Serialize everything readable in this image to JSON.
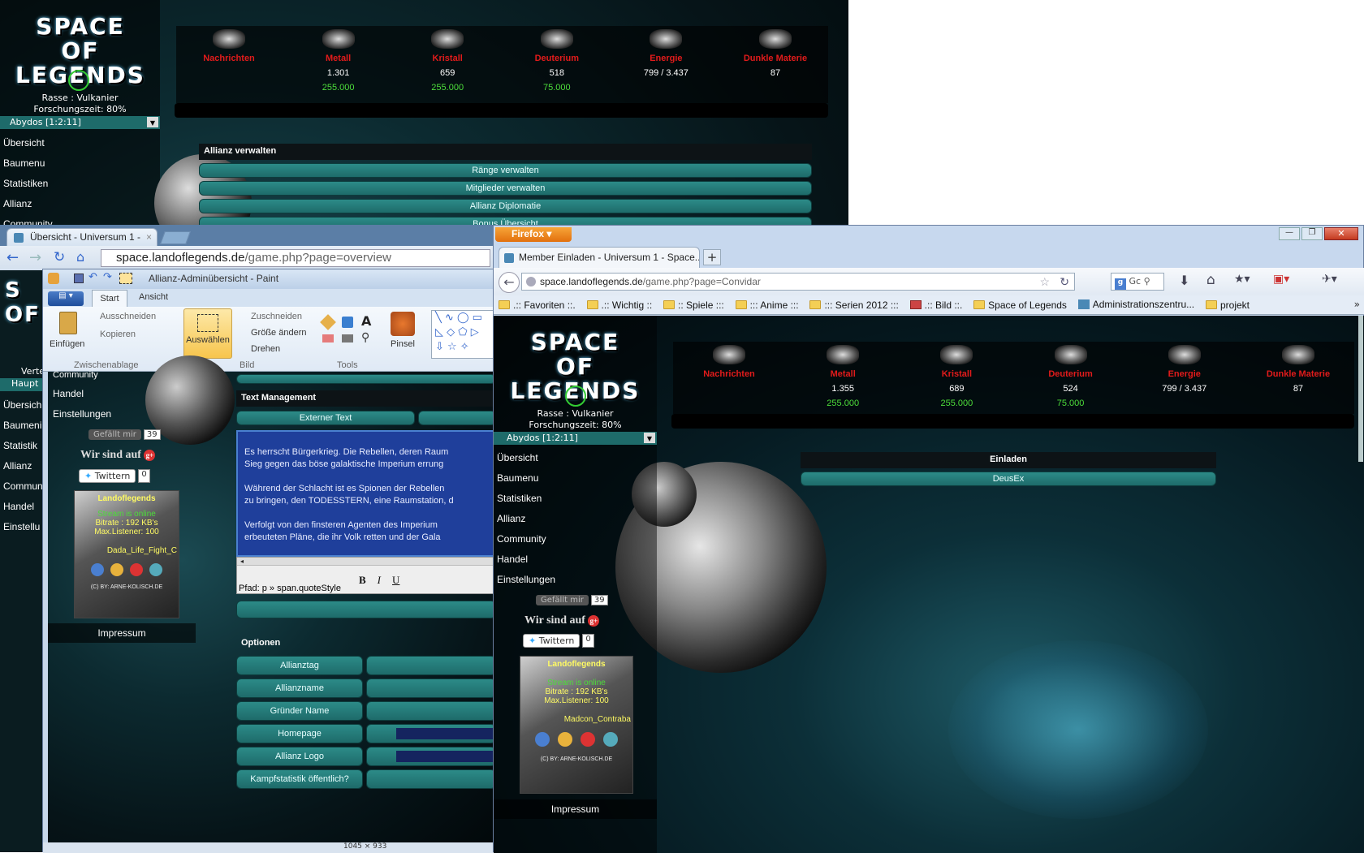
{
  "bg_window": {
    "logo": [
      "SPACE",
      "OF LEGENDS"
    ],
    "race": "Rasse : Vulkanier",
    "research": "Forschungszeit: 80%",
    "planet": "Abydos [1:2:11]",
    "nav": [
      "Übersicht",
      "Baumenu",
      "Statistiken",
      "Allianz",
      "Community"
    ],
    "resources": [
      {
        "name": "Nachrichten",
        "value": "",
        "cap": ""
      },
      {
        "name": "Metall",
        "value": "1.301",
        "cap": "255.000"
      },
      {
        "name": "Kristall",
        "value": "659",
        "cap": "255.000"
      },
      {
        "name": "Deuterium",
        "value": "518",
        "cap": "75.000"
      },
      {
        "name": "Energie",
        "value": "799 / 3.437",
        "cap": ""
      },
      {
        "name": "Dunkle Materie",
        "value": "87",
        "cap": ""
      }
    ],
    "section_title": "Allianz verwalten",
    "buttons": [
      "Ränge verwalten",
      "Mitglieder verwalten",
      "Allianz Diplomatie",
      "Bonus Übersicht"
    ]
  },
  "chrome": {
    "tab_title": "Übersicht - Universum 1 -",
    "url_host": "space.landoflegends.de",
    "url_path": "/game.php?page=overview",
    "left_partial": [
      "Verte",
      "Haupt",
      "Übersich",
      "Baumeni",
      "Statistik",
      "Allianz",
      "Commun",
      "Handel",
      "Einstellu"
    ]
  },
  "paint": {
    "title": "Allianz-Adminübersicht - Paint",
    "tabs": [
      "Start",
      "Ansicht"
    ],
    "clipboard": {
      "paste": "Einfügen",
      "cut": "Ausschneiden",
      "copy": "Kopieren",
      "group": "Zwischenablage"
    },
    "image": {
      "select": "Auswählen",
      "crop": "Zuschneiden",
      "resize": "Größe ändern",
      "rotate": "Drehen",
      "group": "Bild"
    },
    "tools_group": "Tools",
    "brush": "Pinsel",
    "status": "1045 × 933"
  },
  "paint_page": {
    "nav": [
      "Community",
      "Handel",
      "Einstellungen"
    ],
    "like": "Gefällt mir",
    "like_count": "39",
    "wir_sind": "Wir sind auf",
    "twitter": "Twittern",
    "tw_count": "0",
    "radio": {
      "title": "Landoflegends",
      "l1": "Stream is online",
      "l2": "Bitrate : 192 KB's",
      "l3": "Max.Listener: 100",
      "song": "Dada_Life_Fight_C",
      "copy": "(C) BY: ARNE-KOLISCH.DE"
    },
    "impressum": "Impressum",
    "text_mgmt": "Text Management",
    "ext_text": "Externer Text",
    "body_lines": [
      "Es herrscht Bürgerkrieg. Die Rebellen, deren Raum",
      "Sieg gegen das böse galaktische Imperium errung",
      "",
      "Während der Schlacht ist es Spionen der Rebellen",
      "zu bringen, den TODESSTERN, eine Raumstation, d",
      "",
      "Verfolgt von den finsteren Agenten des Imperium",
      "erbeuteten Pläne, die ihr Volk retten und der Gala"
    ],
    "editor_path": "Pfad: p » span.quoteStyle",
    "options_title": "Optionen",
    "options": [
      "Allianztag",
      "Allianzname",
      "Gründer Name",
      "Homepage",
      "Allianz Logo",
      "Kampfstatistik öffentlich?"
    ]
  },
  "firefox": {
    "menu": "Firefox",
    "tab_title": "Member Einladen - Universum 1 - Space...",
    "url_host": "space.landoflegends.de",
    "url_path": "/game.php?page=Convidar",
    "search_placeholder": "Gc",
    "bookmarks": [
      ".:: Favoriten ::.",
      ".:: Wichtig ::",
      ":: Spiele :::",
      "::: Anime :::",
      "::: Serien 2012 :::",
      ".:: Bild ::.",
      "Space of Legends",
      "Administrationszentru...",
      "projekt"
    ],
    "race": "Rasse : Vulkanier",
    "research": "Forschungszeit: 80%",
    "planet": "Abydos [1:2:11]",
    "resources": [
      {
        "name": "Nachrichten",
        "value": "",
        "cap": ""
      },
      {
        "name": "Metall",
        "value": "1.355",
        "cap": "255.000"
      },
      {
        "name": "Kristall",
        "value": "689",
        "cap": "255.000"
      },
      {
        "name": "Deuterium",
        "value": "524",
        "cap": "75.000"
      },
      {
        "name": "Energie",
        "value": "799 / 3.437",
        "cap": ""
      },
      {
        "name": "Dunkle Materie",
        "value": "87",
        "cap": ""
      }
    ],
    "nav": [
      "Übersicht",
      "Baumenu",
      "Statistiken",
      "Allianz",
      "Community",
      "Handel",
      "Einstellungen"
    ],
    "like": "Gefällt mir",
    "like_count": "39",
    "wir_sind": "Wir sind auf",
    "twitter": "Twittern",
    "tw_count": "0",
    "radio": {
      "title": "Landoflegends",
      "l1": "Stream is online",
      "l2": "Bitrate : 192 KB's",
      "l3": "Max.Listener: 100",
      "song": "Madcon_Contraba",
      "copy": "(C) BY: ARNE-KOLISCH.DE"
    },
    "impressum": "Impressum",
    "invite_title": "Einladen",
    "invite_member": "DeusEx"
  }
}
